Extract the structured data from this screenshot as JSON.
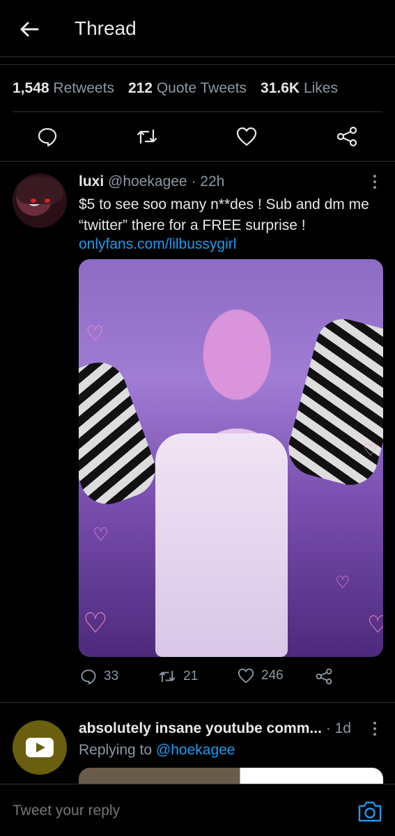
{
  "header": {
    "title": "Thread"
  },
  "stats": {
    "retweets_count": "1,548",
    "retweets_label": "Retweets",
    "quotes_count": "212",
    "quotes_label": "Quote Tweets",
    "likes_count": "31.6K",
    "likes_label": "Likes"
  },
  "tweet": {
    "name": "luxi",
    "handle": "@hoekagee",
    "time": "· 22h",
    "text": "$5 to see soo many n**des ! Sub and dm me “twitter” there for a FREE surprise !",
    "link": "onlyfans.com/lilbussygirl",
    "replies": "33",
    "retweets": "21",
    "likes": "246"
  },
  "tweet2": {
    "name": "absolutely insane youtube comm...",
    "time": "· 1d",
    "replying_prefix": "Replying to",
    "replying_handle": "@hoekagee"
  },
  "composer": {
    "placeholder": "Tweet your reply"
  },
  "colors": {
    "accent": "#1d9bf0",
    "muted": "#8b98a5",
    "border": "#2f3336"
  }
}
